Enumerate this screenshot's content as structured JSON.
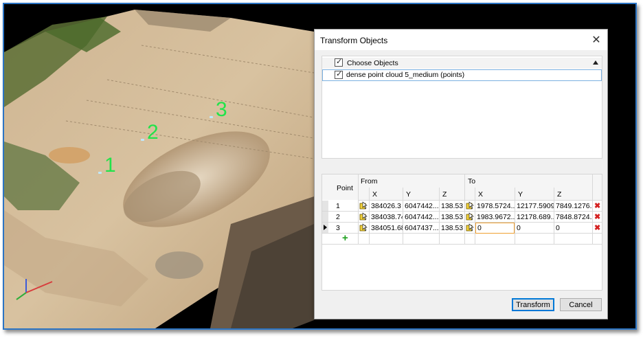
{
  "dialog": {
    "title": "Transform Objects",
    "close_glyph": "✕",
    "objects": {
      "header_label": "Choose Objects",
      "header_checked": true,
      "items": [
        {
          "label": "dense point cloud 5_medium (points)",
          "checked": true
        }
      ]
    },
    "grid": {
      "headers": {
        "point": "Point",
        "from": "From",
        "to": "To",
        "x": "X",
        "y": "Y",
        "z": "Z"
      },
      "rows": [
        {
          "point": "1",
          "from_x": "384026.3",
          "from_y": "6047442....",
          "from_z": "138.53",
          "to_x": "1978.5724...",
          "to_y": "12177.5909",
          "to_z": "7849.1276..."
        },
        {
          "point": "2",
          "from_x": "384038.74",
          "from_y": "6047442....",
          "from_z": "138.53",
          "to_x": "1983.9672...",
          "to_y": "12178.689...",
          "to_z": "7848.8724..."
        },
        {
          "point": "3",
          "from_x": "384051.68",
          "from_y": "6047437....",
          "from_z": "138.53",
          "to_x": "0",
          "to_y": "0",
          "to_z": "0"
        }
      ],
      "add_glyph": "+",
      "delete_glyph": "✖"
    },
    "buttons": {
      "transform": "Transform",
      "cancel": "Cancel"
    }
  },
  "viewport": {
    "markers": [
      "1",
      "2",
      "3"
    ],
    "marker_color": "#22e34a"
  },
  "icons": {
    "pick": "pick-point-icon",
    "delete": "delete-row-icon",
    "add": "add-row-icon",
    "close": "close-icon",
    "current_row": "current-row-arrow-icon"
  }
}
